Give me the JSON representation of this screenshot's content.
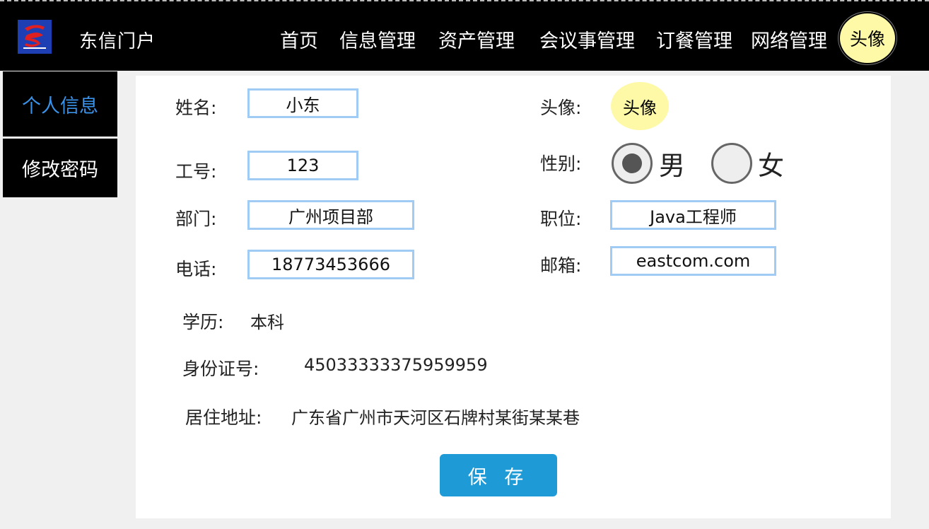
{
  "header": {
    "brand": "东信门户",
    "nav": [
      "首页",
      "信息管理",
      "资产管理",
      "会议事管理",
      "订餐管理",
      "网络管理"
    ],
    "avatar_label": "头像"
  },
  "sidebar": {
    "items": [
      {
        "label": "个人信息",
        "active": true
      },
      {
        "label": "修改密码",
        "active": false
      }
    ]
  },
  "form": {
    "name_label": "姓名:",
    "name_value": "小东",
    "id_label": "工号:",
    "id_value": "123",
    "dept_label": "部门:",
    "dept_value": "广州项目部",
    "phone_label": "电话:",
    "phone_value": "18773453666",
    "avatar_label": "头像:",
    "avatar_text": "头像",
    "gender_label": "性别:",
    "gender_male": "男",
    "gender_female": "女",
    "gender_selected": "男",
    "position_label": "职位:",
    "position_value": "Java工程师",
    "email_label": "邮箱:",
    "email_value": "eastcom.com",
    "education_label": "学历:",
    "education_value": "本科",
    "idcard_label": "身份证号:",
    "idcard_value": "45033333375959959",
    "address_label": "居住地址:",
    "address_value": "广东省广州市天河区石牌村某街某某巷",
    "save_label": "保 存"
  },
  "colors": {
    "topbar": "#000000",
    "sidebar_active_text": "#3a92e8",
    "field_border": "#9fcbf5",
    "avatar_bg": "#fef9a6",
    "save_button": "#1e9bd7"
  }
}
